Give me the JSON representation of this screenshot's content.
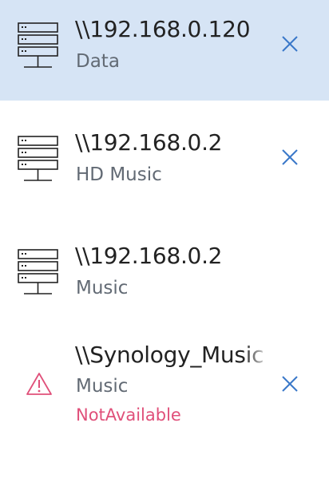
{
  "shares": [
    {
      "host": "\\\\192.168.0.120",
      "name": "Data",
      "icon": "server-icon",
      "selected": true,
      "removable": true
    },
    {
      "host": "\\\\192.168.0.2",
      "name": "HD Music",
      "icon": "server-icon",
      "selected": false,
      "removable": true
    },
    {
      "host": "\\\\192.168.0.2",
      "name": "Music",
      "icon": "server-icon",
      "selected": false,
      "removable": false
    },
    {
      "host": "\\\\Synology_Music",
      "name": "Music",
      "status": "NotAvailable",
      "icon": "warning-icon",
      "selected": false,
      "removable": true
    }
  ],
  "colors": {
    "selected_background": "#d6e4f5",
    "accent": "#3a78c9",
    "warning": "#e0507a",
    "title_text": "#222222",
    "subtitle_text": "#626a74"
  }
}
